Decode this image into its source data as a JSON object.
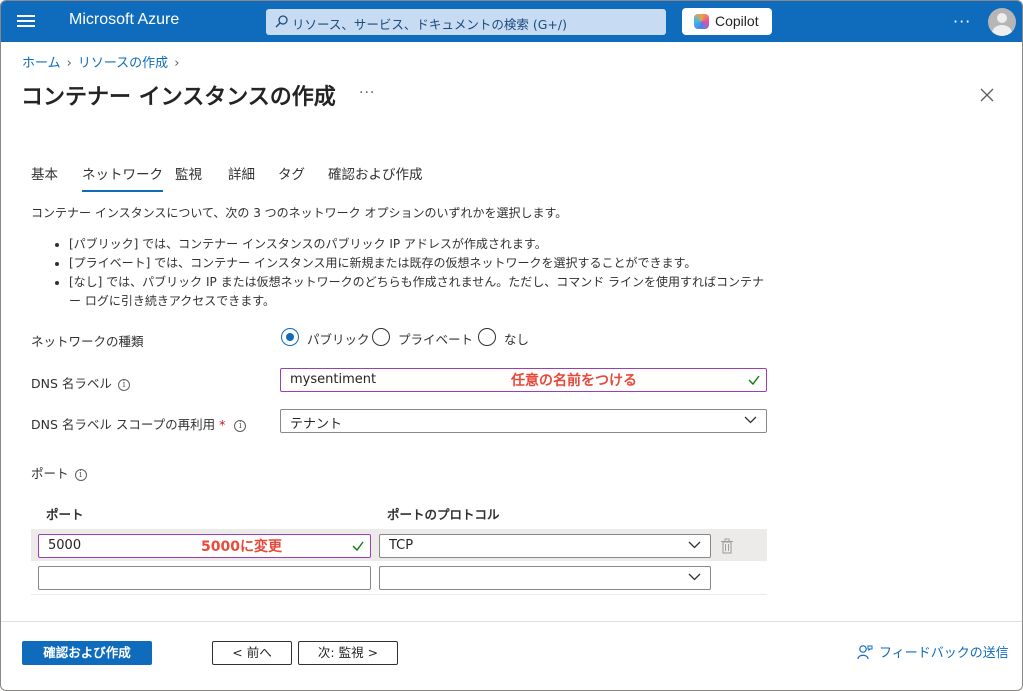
{
  "app": {
    "brand": "Microsoft Azure"
  },
  "search": {
    "placeholder": "リソース、サービス、ドキュメントの検索 (G+/)"
  },
  "copilot": {
    "label": "Copilot"
  },
  "breadcrumb": {
    "items": [
      "ホーム",
      "リソースの作成"
    ]
  },
  "page": {
    "title": "コンテナー インスタンスの作成"
  },
  "tabs": [
    {
      "label": "基本",
      "active": false
    },
    {
      "label": "ネットワーク",
      "active": true
    },
    {
      "label": "監視",
      "active": false
    },
    {
      "label": "詳細",
      "active": false
    },
    {
      "label": "タグ",
      "active": false
    },
    {
      "label": "確認および作成",
      "active": false
    }
  ],
  "intro": "コンテナー インスタンスについて、次の 3 つのネットワーク オプションのいずれかを選択します。",
  "bullets": [
    "[パブリック] では、コンテナー インスタンスのパブリック IP アドレスが作成されます。",
    "[プライベート] では、コンテナー インスタンス用に新規または既存の仮想ネットワークを選択することができます。",
    "[なし] では、パブリック IP または仮想ネットワークのどちらも作成されません。ただし、コマンド ラインを使用すればコンテナー ログに引き続きアクセスできます。"
  ],
  "network_type": {
    "label": "ネットワークの種類",
    "options": [
      "パブリック",
      "プライベート",
      "なし"
    ],
    "selected": "パブリック"
  },
  "dns_label": {
    "label": "DNS 名ラベル",
    "value": "mysentiment",
    "annotation": "任意の名前をつける"
  },
  "dns_scope": {
    "label": "DNS 名ラベル スコープの再利用",
    "required": "*",
    "value": "テナント"
  },
  "ports": {
    "label": "ポート",
    "col_port": "ポート",
    "col_protocol": "ポートのプロトコル",
    "rows": [
      {
        "port": "5000",
        "protocol": "TCP",
        "annotation": "5000に変更"
      },
      {
        "port": "",
        "protocol": ""
      }
    ]
  },
  "footer": {
    "review_create": "確認および作成",
    "prev": "< 前へ",
    "next": "次: 監視 >",
    "feedback": "フィードバックの送信"
  },
  "colors": {
    "azure_blue": "#0f6cbd",
    "annotation_red": "#e8493a",
    "highlight_purple": "#9a3fb6"
  }
}
